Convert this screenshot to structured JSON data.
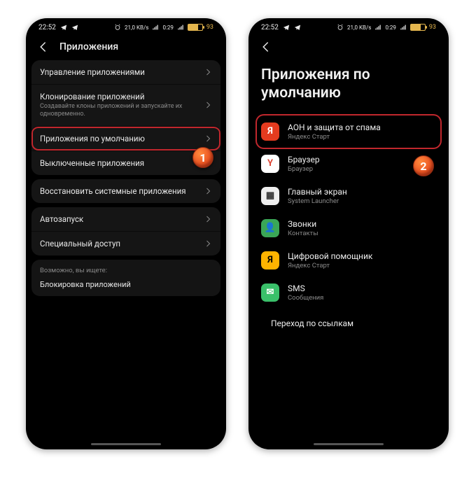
{
  "status": {
    "time": "22:52",
    "net_label": "21,0 KB/s",
    "clock_small": "0:29",
    "battery_text": "93",
    "battery_pct": 70
  },
  "left": {
    "header_title": "Приложения",
    "groups": [
      {
        "rows": [
          {
            "label": "Управление приложениями"
          },
          {
            "label": "Клонирование приложений",
            "sub": "Создавайте клоны приложений и запускайте их одновременно."
          },
          {
            "label": "Приложения по умолчанию",
            "hl": true
          },
          {
            "label": "Выключенные приложения"
          }
        ]
      },
      {
        "rows": [
          {
            "label": "Восстановить системные приложения"
          }
        ]
      },
      {
        "rows": [
          {
            "label": "Автозапуск"
          },
          {
            "label": "Специальный доступ"
          }
        ]
      }
    ],
    "hint_title": "Возможно, вы ищете:",
    "hint_link": "Блокировка приложений",
    "badge": "1"
  },
  "right": {
    "title": "Приложения по умолчанию",
    "items": [
      {
        "title": "АОН и защита от спама",
        "sub": "Яндекс Старт",
        "icon": "ya-red",
        "glyph": "Я",
        "hl": true
      },
      {
        "title": "Браузер",
        "sub": "Браузер",
        "icon": "ya-wh",
        "glyph": "Y"
      },
      {
        "title": "Главный экран",
        "sub": "System Launcher",
        "icon": "launch",
        "glyph": "▦"
      },
      {
        "title": "Звонки",
        "sub": "Контакты",
        "icon": "calls",
        "glyph": "👤"
      },
      {
        "title": "Цифровой помощник",
        "sub": "Яндекс Старт",
        "icon": "ya-o",
        "glyph": "Я"
      },
      {
        "title": "SMS",
        "sub": "Сообщения",
        "icon": "sms",
        "glyph": "✉"
      }
    ],
    "links_label": "Переход по ссылкам",
    "badge": "2"
  }
}
